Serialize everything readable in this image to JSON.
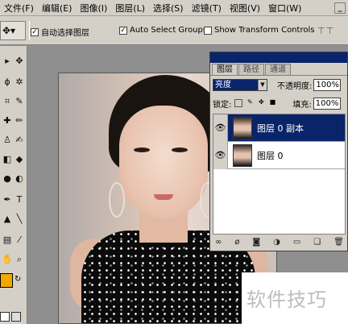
{
  "menubar": {
    "items": [
      "文件(F)",
      "编辑(E)",
      "图像(I)",
      "图层(L)",
      "选择(S)",
      "滤镜(T)",
      "视图(V)",
      "窗口(W)"
    ],
    "window_buttons": [
      "_",
      "□"
    ]
  },
  "options": {
    "auto_select_layer": "自动选择图层",
    "auto_select_groups": "Auto Select Groups",
    "show_transform": "Show Transform Controls",
    "tool_glyph": "✥▾",
    "align_glyphs": "⊤⊤"
  },
  "tools": {
    "foreground_color": "#f2a800",
    "background_color": "#ffffff",
    "glyphs": [
      "▶",
      "⬚",
      "✂",
      "✎",
      "⌖",
      "✒",
      "T",
      "✋",
      "🔍",
      "⟲"
    ]
  },
  "layers_panel": {
    "tabs": [
      "图层",
      "路径",
      "通道"
    ],
    "blend_mode": "亮度",
    "opacity_label": "不透明度:",
    "opacity_value": "100%",
    "lock_label": "锁定:",
    "fill_label": "填充:",
    "fill_value": "100%",
    "layers": [
      {
        "name": "图层 0 副本",
        "selected": true
      },
      {
        "name": "图层 0",
        "selected": false
      }
    ],
    "footer_icons": [
      "link-icon",
      "fx-icon",
      "mask-icon",
      "adjustment-icon",
      "folder-icon",
      "new-layer-icon",
      "trash-icon"
    ]
  },
  "watermark": "软件技巧"
}
